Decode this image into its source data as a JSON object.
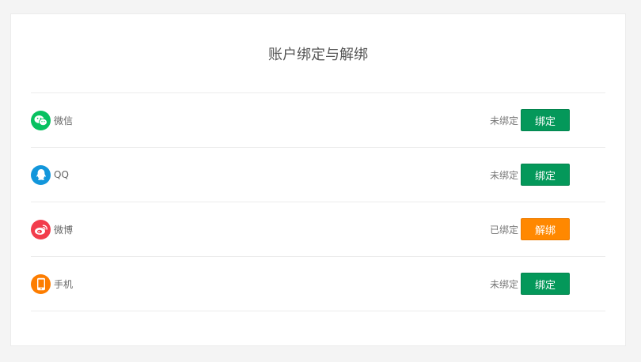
{
  "page": {
    "title": "账户绑定与解绑"
  },
  "colors": {
    "bind_button": "#04985a",
    "unbind_button": "#ff8800",
    "wechat": "#07c160",
    "qq": "#1296db",
    "weibo": "#f23d4c",
    "phone": "#fd7d00"
  },
  "accounts": [
    {
      "icon": "wechat-icon",
      "name": "微信",
      "status": "未绑定",
      "action": "绑定"
    },
    {
      "icon": "qq-icon",
      "name": "QQ",
      "status": "未绑定",
      "action": "绑定"
    },
    {
      "icon": "weibo-icon",
      "name": "微博",
      "status": "已绑定",
      "action": "解绑"
    },
    {
      "icon": "phone-icon",
      "name": "手机",
      "status": "未绑定",
      "action": "绑定"
    }
  ]
}
